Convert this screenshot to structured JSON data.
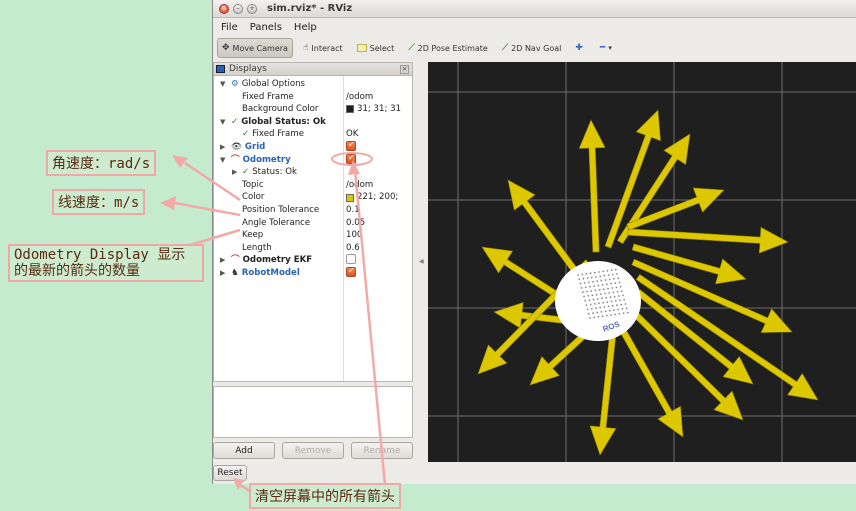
{
  "window": {
    "title": "sim.rviz* - RViz",
    "menu": [
      "File",
      "Panels",
      "Help"
    ]
  },
  "toolbar": {
    "move_camera": "Move Camera",
    "interact": "Interact",
    "select": "Select",
    "pose_estimate": "2D Pose Estimate",
    "nav_goal": "2D Nav Goal"
  },
  "displays": {
    "title": "Displays",
    "global_options": "Global Options",
    "fixed_frame_label": "Fixed Frame",
    "fixed_frame_value": "/odom",
    "background_label": "Background Color",
    "background_value": "31; 31; 31",
    "global_status": "Global Status: Ok",
    "status_fixed_frame": "Fixed Frame",
    "status_fixed_frame_value": "OK",
    "grid": "Grid",
    "odometry": "Odometry",
    "status_ok": "Status: Ok",
    "topic_label": "Topic",
    "topic_value": "/odom",
    "color_label": "Color",
    "color_value": "221; 200;",
    "pos_tol_label": "Position Tolerance",
    "pos_tol_value": "0.1",
    "ang_tol_label": "Angle Tolerance",
    "ang_tol_value": "0.05",
    "keep_label": "Keep",
    "keep_value": "100",
    "length_label": "Length",
    "length_value": "0.6",
    "odometry_ekf": "Odometry EKF",
    "robot_model": "RobotModel"
  },
  "colors": {
    "background": "#1f1f1f",
    "arrow": "#ddc800",
    "accent": "#2b64b6"
  },
  "buttons": {
    "add": "Add",
    "remove": "Remove",
    "rename": "Rename",
    "reset": "Reset"
  },
  "annotations": {
    "angular_velocity": "角速度：rad/s",
    "linear_velocity": "线速度：m/s",
    "odometry_display": "Odometry Display 显示的最新的箭头的数量",
    "clear_screen": "清空屏幕中的所有箭头"
  },
  "robot": {
    "logo": "ROS"
  }
}
